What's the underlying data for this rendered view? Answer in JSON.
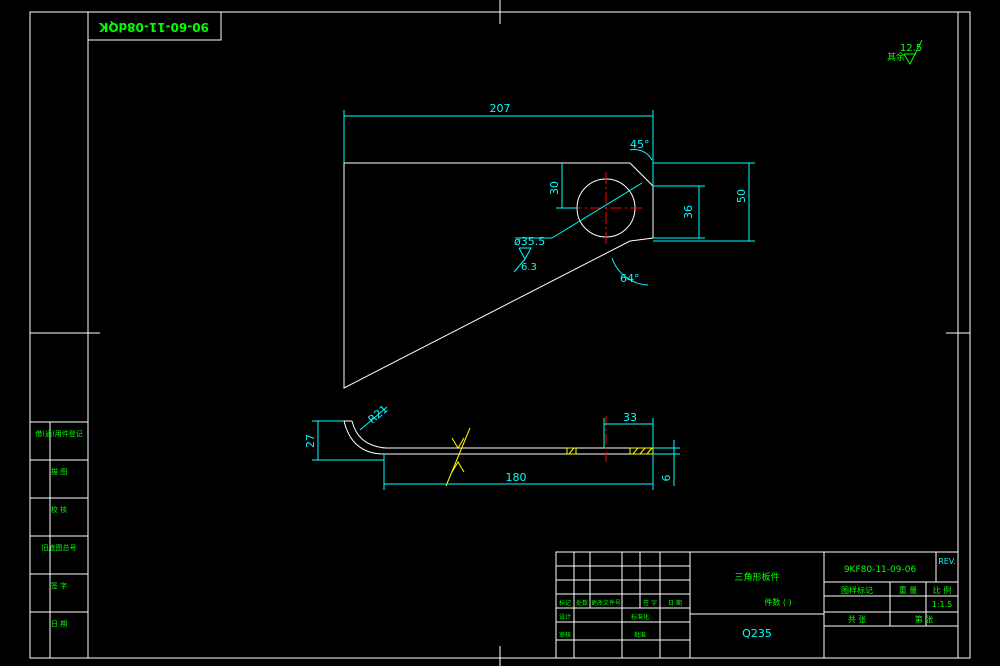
{
  "title_block_top": {
    "drawing_number_mirrored": "90-60-11-08dQK"
  },
  "surface_roughness_general": {
    "value": "12.5",
    "label": "其余"
  },
  "dimensions": {
    "width_207": "207",
    "angle_45": "45°",
    "height_30": "30",
    "height_36": "36",
    "height_50": "50",
    "diameter": "ø35.5",
    "hole_roughness": "6.3",
    "angle_64": "64°",
    "radius": "R21",
    "height_27": "27",
    "length_33": "33",
    "length_180": "180",
    "thickness_6": "6"
  },
  "left_column_labels": [
    "借(通)用件登记",
    "描 图",
    "校 核",
    "旧底图总号",
    "签 字",
    "日 期"
  ],
  "title_block": {
    "part_name": "三角形板件",
    "drawing_number": "9KF80-11-09-06",
    "rev_label": "REV.",
    "material": "Q235",
    "quantity_label": "件数 (  )",
    "scale": "1:1.5",
    "stage_label": "图样标记",
    "weight_label": "重 量",
    "scale_label": "比 例",
    "sheet_label": "共 张",
    "sheet_label_2": "第 张",
    "row_labels": [
      "标记",
      "处数",
      "更改文件号",
      "签 字",
      "日 期",
      "设计",
      "标准化",
      "审核",
      "批准"
    ]
  },
  "colors": {
    "background": "#000000",
    "outline": "#ffffff",
    "dimension": "#00ffff",
    "text_green": "#00ff00",
    "center_line": "#ff0000",
    "hatch": "#ffff00"
  }
}
